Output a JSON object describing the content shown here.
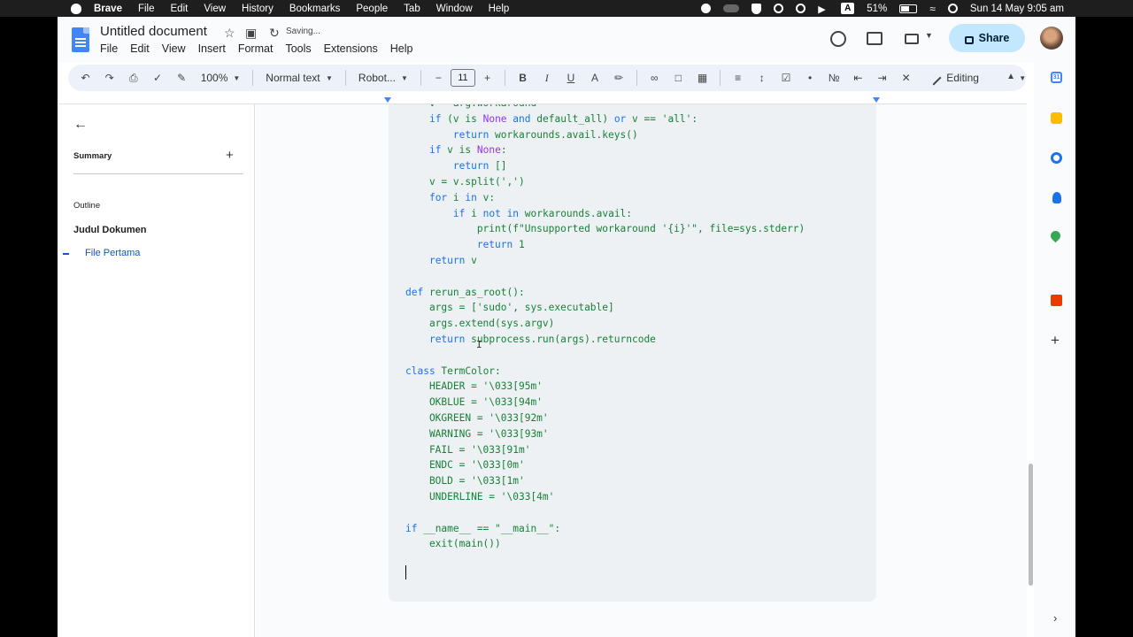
{
  "menubar": {
    "app_name": "Brave",
    "items": [
      "File",
      "Edit",
      "View",
      "History",
      "Bookmarks",
      "People",
      "Tab",
      "Window",
      "Help"
    ],
    "status_a": "A",
    "battery": "51%",
    "datetime": "Sun 14 May  9:05 am"
  },
  "docs": {
    "title": "Untitled document",
    "saving": "Saving...",
    "menu": [
      "File",
      "Edit",
      "View",
      "Insert",
      "Format",
      "Tools",
      "Extensions",
      "Help"
    ],
    "share_label": "Share"
  },
  "toolbar": {
    "zoom": "100%",
    "style": "Normal text",
    "font": "Robot...",
    "font_size": "11",
    "bold": "B",
    "italic": "I",
    "underline": "U",
    "text_color": "A",
    "mode": "Editing"
  },
  "outline_panel": {
    "summary_label": "Summary",
    "outline_label": "Outline",
    "heading": "Judul Dokumen",
    "subheading": "File Pertama"
  },
  "code": {
    "lines": [
      "    v = arg.workaround",
      "    if (v is None and default_all) or v == 'all':",
      "        return workarounds.avail.keys()",
      "    if v is None:",
      "        return []",
      "    v = v.split(',')",
      "    for i in v:",
      "        if i not in workarounds.avail:",
      "            print(f\"Unsupported workaround '{i}'\", file=sys.stderr)",
      "            return 1",
      "    return v",
      "",
      "def rerun_as_root():",
      "    args = ['sudo', sys.executable]",
      "    args.extend(sys.argv)",
      "    return subprocess.run(args).returncode",
      "",
      "class TermColor:",
      "    HEADER = '\\033[95m'",
      "    OKBLUE = '\\033[94m'",
      "    OKGREEN = '\\033[92m'",
      "    WARNING = '\\033[93m'",
      "    FAIL = '\\033[91m'",
      "    ENDC = '\\033[0m'",
      "    BOLD = '\\033[1m'",
      "    UNDERLINE = '\\033[4m'",
      "",
      "if __name__ == \"__main__\":",
      "    exit(main())"
    ]
  },
  "side_panel": {
    "calendar_day": "31"
  }
}
